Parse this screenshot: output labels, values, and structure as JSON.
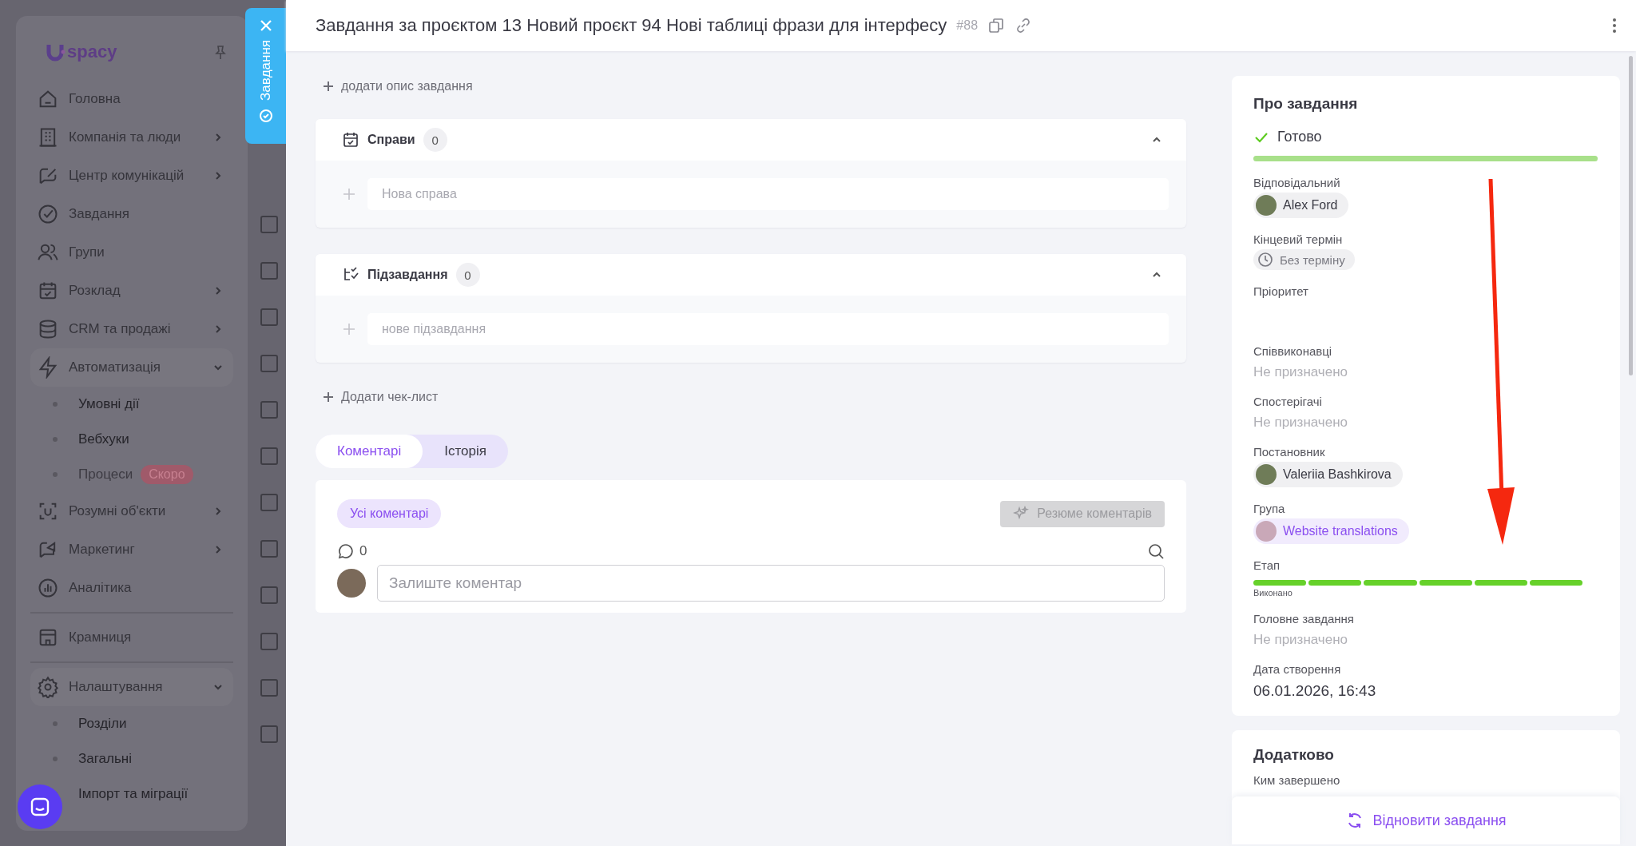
{
  "sidebar": {
    "logo": "spacy",
    "items": [
      {
        "label": "Головна",
        "kind": "link"
      },
      {
        "label": "Компанія та люди",
        "kind": "group",
        "expanded": false
      },
      {
        "label": "Центр комунікацій",
        "kind": "group",
        "expanded": false
      },
      {
        "label": "Завдання",
        "kind": "link"
      },
      {
        "label": "Групи",
        "kind": "link"
      },
      {
        "label": "Розклад",
        "kind": "group",
        "expanded": false
      },
      {
        "label": "CRM та продажі",
        "kind": "group",
        "expanded": false
      },
      {
        "label": "Автоматизація",
        "kind": "group",
        "expanded": true,
        "children": [
          {
            "label": "Умовні дії",
            "disabled": false
          },
          {
            "label": "Вебхуки",
            "disabled": false
          },
          {
            "label": "Процеси",
            "disabled": true,
            "badge": "Скоро"
          }
        ]
      },
      {
        "label": "Розумні об'єкти",
        "kind": "group",
        "expanded": false
      },
      {
        "label": "Маркетинг",
        "kind": "group",
        "expanded": false
      },
      {
        "label": "Аналітика",
        "kind": "link"
      },
      {
        "label": "Крамниця",
        "kind": "link",
        "divider_before": true
      },
      {
        "label": "Налаштування",
        "kind": "group",
        "expanded": true,
        "divider_before": true,
        "children": [
          {
            "label": "Розділи",
            "disabled": false
          },
          {
            "label": "Загальні",
            "disabled": false
          },
          {
            "label": "Імпорт та міграції",
            "disabled": false
          }
        ]
      }
    ]
  },
  "background_rows": [
    {
      "checked": false
    },
    {
      "checked": false
    },
    {
      "checked": false
    },
    {
      "checked": false
    },
    {
      "checked": false
    },
    {
      "checked": false
    },
    {
      "checked": false
    },
    {
      "checked": false
    },
    {
      "checked": false
    },
    {
      "checked": false
    },
    {
      "checked": false
    },
    {
      "checked": false
    }
  ],
  "drawer_tab": {
    "label": "Завдання"
  },
  "header": {
    "title": "Завдання за проєктом 13 Новий проєкт 94 Нові таблиці фрази для інтерфесу",
    "number": "#88"
  },
  "main": {
    "add_description": "додати опис завдання",
    "sections": [
      {
        "title": "Справи",
        "count": "0",
        "placeholder": "Нова справа",
        "expanded": true
      },
      {
        "title": "Підзавдання",
        "count": "0",
        "placeholder": "нове підзавдання",
        "expanded": true
      }
    ],
    "add_checklist": "Додати чек-лист",
    "tabs": [
      {
        "label": "Коментарі",
        "selected": true
      },
      {
        "label": "Історія",
        "selected": false
      }
    ],
    "comments": {
      "filter": "Усі коментарі",
      "summary_button": {
        "label": "Резюме коментарів",
        "disabled": true
      },
      "count": "0",
      "placeholder": "Залиште коментар"
    }
  },
  "about": {
    "title": "Про завдання",
    "status": {
      "label": "Готово",
      "level": 1
    },
    "fields": [
      {
        "label": "Відповідальний",
        "kind": "person",
        "value": "Alex Ford"
      },
      {
        "label": "Кінцевий термін",
        "kind": "deadline",
        "value": "Без терміну"
      },
      {
        "label": "Пріоритет",
        "kind": "empty"
      },
      {
        "label": "Співвиконавці",
        "kind": "none",
        "value": "Не призначено"
      },
      {
        "label": "Спостерігачі",
        "kind": "none",
        "value": "Не призначено"
      },
      {
        "label": "Постановник",
        "kind": "person",
        "value": "Valeriia Bashkirova"
      },
      {
        "label": "Група",
        "kind": "group",
        "value": "Website translations"
      },
      {
        "label": "Етап",
        "kind": "stage",
        "value": "Виконано",
        "segments": [
          {
            "done": true
          },
          {
            "done": true
          },
          {
            "done": true
          },
          {
            "done": true
          },
          {
            "done": true
          },
          {
            "done": true
          }
        ]
      },
      {
        "label": "Головне завдання",
        "kind": "none",
        "value": "Не призначено"
      },
      {
        "label": "Дата створення",
        "kind": "date",
        "value": "06.01.2026, 16:43"
      }
    ]
  },
  "extra": {
    "title": "Додатково",
    "fields": [
      {
        "label": "Ким завершено"
      }
    ]
  },
  "restore_button": "Відновити завдання"
}
